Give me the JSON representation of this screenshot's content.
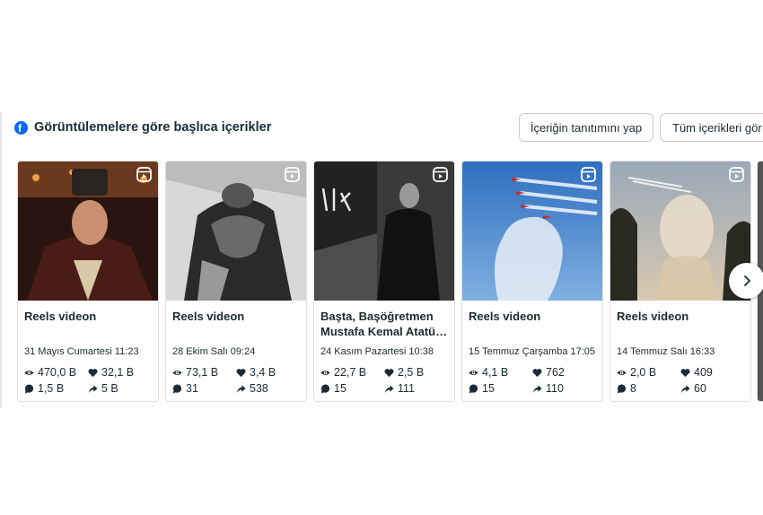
{
  "header": {
    "title": "Görüntülemelere göre başlıca içerikler",
    "promote_button": "İçeriğin tanıtımını yap",
    "all_content_button": "Tüm içerikleri gör"
  },
  "posts": [
    {
      "title": "Reels videon",
      "date": "31 Mayıs Cumartesi 11:23",
      "views": "470,0 B",
      "likes": "32,1 B",
      "comments": "1,5 B",
      "shares": "5 B"
    },
    {
      "title": "Reels videon",
      "date": "28 Ekim Salı 09:24",
      "views": "73,1 B",
      "likes": "3,4 B",
      "comments": "31",
      "shares": "538"
    },
    {
      "title": "Başta, Başöğretmen Mustafa Kemal Atatü…",
      "date": "24 Kasım Pazartesi 10:38",
      "views": "22,7 B",
      "likes": "2,5 B",
      "comments": "15",
      "shares": "111"
    },
    {
      "title": "Reels videon",
      "date": "15 Temmuz Çarşamba 17:05",
      "views": "4,1 B",
      "likes": "762",
      "comments": "15",
      "shares": "110"
    },
    {
      "title": "Reels videon",
      "date": "14 Temmuz Salı 16:33",
      "views": "2,0 B",
      "likes": "409",
      "comments": "8",
      "shares": "60"
    }
  ],
  "icons": {
    "brand": "facebook-icon",
    "reels": "reels-icon",
    "views": "eye-icon",
    "likes": "heart-icon",
    "comments": "comment-icon",
    "shares": "share-icon",
    "next": "chevron-right-icon"
  },
  "colors": {
    "brand": "#0866ff",
    "text": "#1c2b33",
    "border": "#dfe1e5"
  }
}
